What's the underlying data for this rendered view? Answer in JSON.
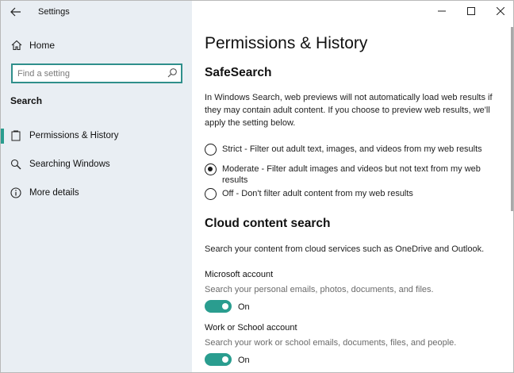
{
  "window": {
    "title": "Settings"
  },
  "sidebar": {
    "home_label": "Home",
    "search": {
      "placeholder": "Find a setting",
      "value": ""
    },
    "section_label": "Search",
    "items": [
      {
        "label": "Permissions & History",
        "icon": "permissions-icon",
        "active": true
      },
      {
        "label": "Searching Windows",
        "icon": "search-icon",
        "active": false
      },
      {
        "label": "More details",
        "icon": "info-icon",
        "active": false
      }
    ]
  },
  "main": {
    "page_title": "Permissions & History",
    "safesearch": {
      "heading": "SafeSearch",
      "description": "In Windows Search, web previews will not automatically load web results if they may contain adult content. If you choose to preview web results, we'll apply the setting below.",
      "options": [
        {
          "label": "Strict - Filter out adult text, images, and videos from my web results",
          "checked": false
        },
        {
          "label": "Moderate - Filter adult images and videos but not text from my web results",
          "checked": true
        },
        {
          "label": "Off - Don't filter adult content from my web results",
          "checked": false
        }
      ]
    },
    "cloud": {
      "heading": "Cloud content search",
      "description": "Search your content from cloud services such as OneDrive and Outlook.",
      "accounts": [
        {
          "title": "Microsoft account",
          "subtitle": "Search your personal emails, photos, documents, and files.",
          "state": "On"
        },
        {
          "title": "Work or School account",
          "subtitle": "Search your work or school emails, documents, files, and people.",
          "state": "On"
        }
      ]
    }
  },
  "colors": {
    "accent": "#2a9d8f",
    "sidebar_bg": "#e9eef3"
  }
}
